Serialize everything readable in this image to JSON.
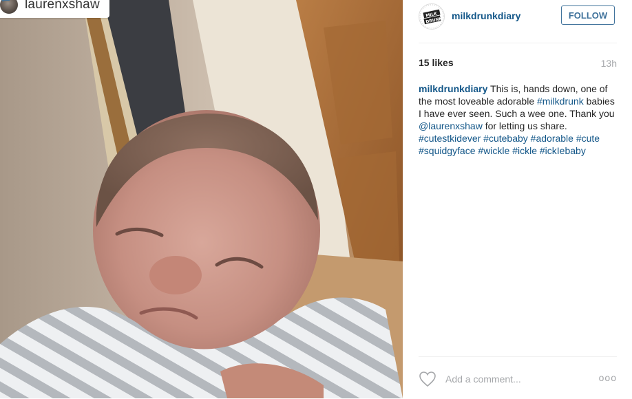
{
  "post_image": {
    "regram_username": "laurenxshaw"
  },
  "header": {
    "username": "milkdrunkdiary",
    "avatar_logo_line1": "MILK",
    "avatar_logo_line2": "DRUNK",
    "follow_label": "FOLLOW"
  },
  "stats": {
    "likes": "15 likes",
    "time": "13h"
  },
  "caption": {
    "username": "milkdrunkdiary",
    "text1": " This is, hands down, one of the most loveable adorable ",
    "tag_milkdrunk": "#milkdrunk",
    "text2": " babies I have ever seen. Such a wee one. Thank you ",
    "mention": "@laurenxshaw",
    "text3": " for letting us share. ",
    "tag1": "#cutestkidever",
    "tag2": "#cutebaby",
    "tag3": "#adorable",
    "tag4": "#cute",
    "tag5": "#squidgyface",
    "tag6": "#wickle",
    "tag7": "#ickle",
    "tag8": "#ickIebaby"
  },
  "footer": {
    "comment_placeholder": "Add a comment...",
    "more_label": "ooo"
  },
  "icons": {
    "regram": "regram-icon",
    "heart": "heart-icon",
    "more": "more-options-icon"
  }
}
